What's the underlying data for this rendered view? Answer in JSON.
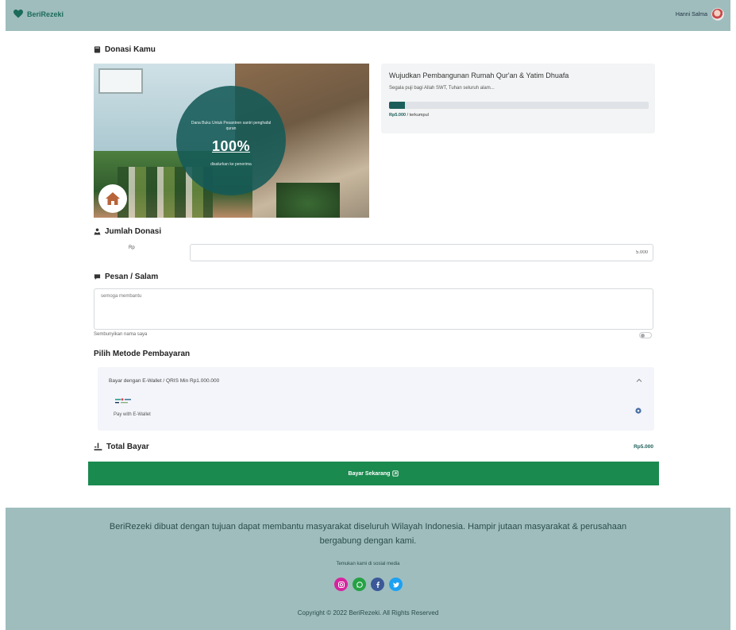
{
  "navbar": {
    "brand": "BeriRezeki",
    "user_name": "Hanni Salma"
  },
  "donation": {
    "section_title": "Donasi Kamu",
    "image": {
      "overlay_text_top": "Dana Buku Untuk Pesantren santri penghafal quran",
      "overlay_percent": "100%",
      "overlay_text_bottom": "disalurkan ke penerima"
    },
    "campaign": {
      "title": "Wujudkan Pembangunan Rumah Qur'an & Yatim Dhuafa",
      "description": "Segala puji bagi Allah SWT, Tuhan seluruh alam...",
      "progress_percent": 6,
      "raised_amount": "Rp5.000",
      "raised_note": "/ terkumpul"
    }
  },
  "amount": {
    "section_title": "Jumlah Donasi",
    "prefix": "Rp",
    "value": "5.000"
  },
  "message": {
    "section_title": "Pesan / Salam",
    "placeholder": "semoga membantu",
    "anonymous_label": "Sembunyikan nama saya"
  },
  "payment": {
    "section_title": "Pilih Metode Pembayaran",
    "method_header": "Bayar dengan E-Wallet / QRIS Min Rp1.000.000",
    "method_sub": "Pay with E-Wallet"
  },
  "total": {
    "label": "Total Bayar",
    "value": "Rp5.000"
  },
  "pay_button": {
    "label": "Bayar Sekarang"
  },
  "footer": {
    "description": "BeriRezeki dibuat dengan tujuan dapat membantu masyarakat diseluruh Wilayah Indonesia. Hampir jutaan masyarakat & perusahaan bergabung dengan kami.",
    "follow": "Temukan kami di sosial media",
    "copyright": "Copyright © 2022 BeriRezeki. All Rights Reserved"
  },
  "colors": {
    "navbar": "#9fbdbd",
    "primary_green": "#1a8a4f",
    "teal_dark": "#1b5e5a",
    "instagram": "#d6249f",
    "whatsapp": "#25a244",
    "facebook": "#3b5998",
    "twitter": "#1da1f2"
  },
  "icons": [
    "heart-icon",
    "book-icon",
    "hands-icon",
    "chat-icon",
    "chevron-up-icon",
    "gear-icon",
    "hand-coin-icon",
    "arrow-icon",
    "instagram-icon",
    "whatsapp-icon",
    "facebook-icon",
    "twitter-icon",
    "home-icon"
  ]
}
